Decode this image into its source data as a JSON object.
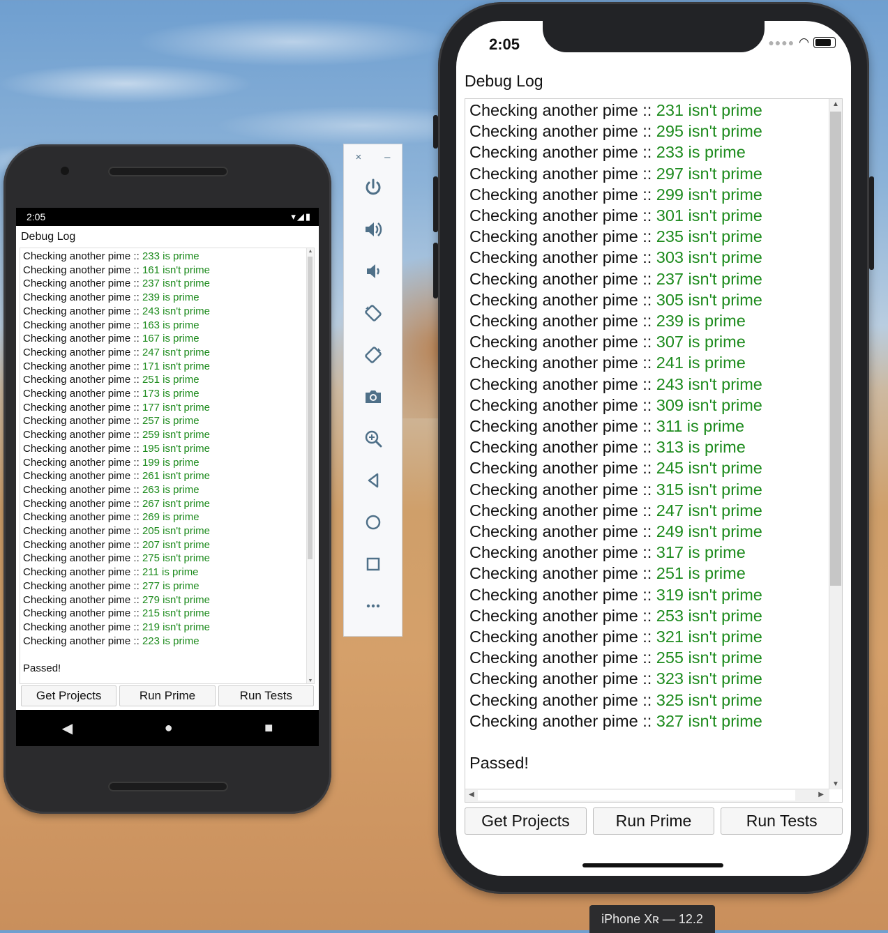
{
  "android": {
    "status_time": "2:05",
    "title": "Debug Log",
    "log": [
      {
        "text": "Checking another pime :: ",
        "result": "233 is prime"
      },
      {
        "text": "Checking another pime :: ",
        "result": "161 isn't prime"
      },
      {
        "text": "Checking another pime :: ",
        "result": "237 isn't prime"
      },
      {
        "text": "Checking another pime :: ",
        "result": "239 is prime"
      },
      {
        "text": "Checking another pime :: ",
        "result": "243 isn't prime"
      },
      {
        "text": "Checking another pime :: ",
        "result": "163 is prime"
      },
      {
        "text": "Checking another pime :: ",
        "result": "167 is prime"
      },
      {
        "text": "Checking another pime :: ",
        "result": "247 isn't prime"
      },
      {
        "text": "Checking another pime :: ",
        "result": "171 isn't prime"
      },
      {
        "text": "Checking another pime :: ",
        "result": "251 is prime"
      },
      {
        "text": "Checking another pime :: ",
        "result": "173 is prime"
      },
      {
        "text": "Checking another pime :: ",
        "result": "177 isn't prime"
      },
      {
        "text": "Checking another pime :: ",
        "result": "257 is prime"
      },
      {
        "text": "Checking another pime :: ",
        "result": "259 isn't prime"
      },
      {
        "text": "Checking another pime :: ",
        "result": "195 isn't prime"
      },
      {
        "text": "Checking another pime :: ",
        "result": "199 is prime"
      },
      {
        "text": "Checking another pime :: ",
        "result": "261 isn't prime"
      },
      {
        "text": "Checking another pime :: ",
        "result": "263 is prime"
      },
      {
        "text": "Checking another pime :: ",
        "result": "267 isn't prime"
      },
      {
        "text": "Checking another pime :: ",
        "result": "269 is prime"
      },
      {
        "text": "Checking another pime :: ",
        "result": "205 isn't prime"
      },
      {
        "text": "Checking another pime :: ",
        "result": "207 isn't prime"
      },
      {
        "text": "Checking another pime :: ",
        "result": "275 isn't prime"
      },
      {
        "text": "Checking another pime :: ",
        "result": "211 is prime"
      },
      {
        "text": "Checking another pime :: ",
        "result": "277 is prime"
      },
      {
        "text": "Checking another pime :: ",
        "result": "279 isn't prime"
      },
      {
        "text": "Checking another pime :: ",
        "result": "215 isn't prime"
      },
      {
        "text": "Checking another pime :: ",
        "result": "219 isn't prime"
      },
      {
        "text": "Checking another pime :: ",
        "result": "223 is prime"
      }
    ],
    "final": "Passed!",
    "buttons": {
      "get_projects": "Get Projects",
      "run_prime": "Run Prime",
      "run_tests": "Run Tests"
    }
  },
  "toolbar": {
    "close": "×",
    "minimize": "–",
    "tools": [
      "power-icon",
      "volume-up-icon",
      "volume-down-icon",
      "rotate-left-icon",
      "rotate-right-icon",
      "camera-icon",
      "zoom-icon",
      "back-icon",
      "home-icon",
      "overview-icon",
      "more-icon"
    ]
  },
  "iphone": {
    "status_time": "2:05",
    "title": "Debug Log",
    "log": [
      {
        "text": "Checking another pime :: ",
        "result": "231 isn't prime"
      },
      {
        "text": "Checking another pime :: ",
        "result": "295 isn't prime"
      },
      {
        "text": "Checking another pime :: ",
        "result": "233 is prime"
      },
      {
        "text": "Checking another pime :: ",
        "result": "297 isn't prime"
      },
      {
        "text": "Checking another pime :: ",
        "result": "299 isn't prime"
      },
      {
        "text": "Checking another pime :: ",
        "result": "301 isn't prime"
      },
      {
        "text": "Checking another pime :: ",
        "result": "235 isn't prime"
      },
      {
        "text": "Checking another pime :: ",
        "result": "303 isn't prime"
      },
      {
        "text": "Checking another pime :: ",
        "result": "237 isn't prime"
      },
      {
        "text": "Checking another pime :: ",
        "result": "305 isn't prime"
      },
      {
        "text": "Checking another pime :: ",
        "result": "239 is prime"
      },
      {
        "text": "Checking another pime :: ",
        "result": "307 is prime"
      },
      {
        "text": "Checking another pime :: ",
        "result": "241 is prime"
      },
      {
        "text": "Checking another pime :: ",
        "result": "243 isn't prime"
      },
      {
        "text": "Checking another pime :: ",
        "result": "309 isn't prime"
      },
      {
        "text": "Checking another pime :: ",
        "result": "311 is prime"
      },
      {
        "text": "Checking another pime :: ",
        "result": "313 is prime"
      },
      {
        "text": "Checking another pime :: ",
        "result": "245 isn't prime"
      },
      {
        "text": "Checking another pime :: ",
        "result": "315 isn't prime"
      },
      {
        "text": "Checking another pime :: ",
        "result": "247 isn't prime"
      },
      {
        "text": "Checking another pime :: ",
        "result": "249 isn't prime"
      },
      {
        "text": "Checking another pime :: ",
        "result": "317 is prime"
      },
      {
        "text": "Checking another pime :: ",
        "result": "251 is prime"
      },
      {
        "text": "Checking another pime :: ",
        "result": "319 isn't prime"
      },
      {
        "text": "Checking another pime :: ",
        "result": "253 isn't prime"
      },
      {
        "text": "Checking another pime :: ",
        "result": "321 isn't prime"
      },
      {
        "text": "Checking another pime :: ",
        "result": "255 isn't prime"
      },
      {
        "text": "Checking another pime :: ",
        "result": "323 isn't prime"
      },
      {
        "text": "Checking another pime :: ",
        "result": "325 isn't prime"
      },
      {
        "text": "Checking another pime :: ",
        "result": "327 isn't prime"
      }
    ],
    "final": "Passed!",
    "buttons": {
      "get_projects": "Get Projects",
      "run_prime": "Run Prime",
      "run_tests": "Run Tests"
    }
  },
  "simulator_label": "iPhone Xʀ — 12.2",
  "colors": {
    "prime_result": "#1c8a1c"
  }
}
